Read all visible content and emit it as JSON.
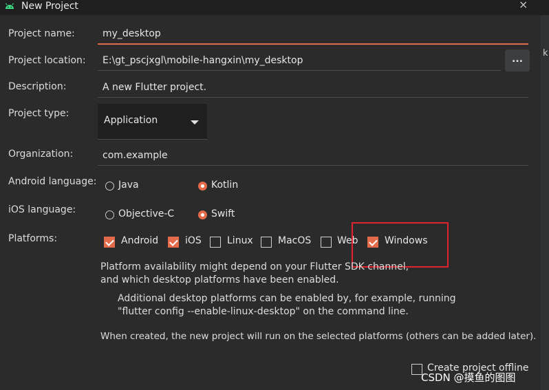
{
  "window": {
    "title": "New Project",
    "close_glyph": "×"
  },
  "form": {
    "project_name": {
      "label": "Project name:",
      "value": "my_desktop"
    },
    "project_location": {
      "label": "Project location:",
      "value": "E:\\gt_pscjxgl\\mobile-hangxin\\my_desktop",
      "browse_label": "..."
    },
    "description": {
      "label": "Description:",
      "value": "A new Flutter project."
    },
    "project_type": {
      "label": "Project type:",
      "value": "Application"
    },
    "organization": {
      "label": "Organization:",
      "value": "com.example"
    },
    "android_language": {
      "label": "Android language:",
      "options": [
        {
          "label": "Java",
          "selected": false
        },
        {
          "label": "Kotlin",
          "selected": true
        }
      ]
    },
    "ios_language": {
      "label": "iOS language:",
      "options": [
        {
          "label": "Objective-C",
          "selected": false
        },
        {
          "label": "Swift",
          "selected": true
        }
      ]
    },
    "platforms": {
      "label": "Platforms:",
      "items": [
        {
          "label": "Android",
          "checked": true
        },
        {
          "label": "iOS",
          "checked": true
        },
        {
          "label": "Linux",
          "checked": false
        },
        {
          "label": "MacOS",
          "checked": false
        },
        {
          "label": "Web",
          "checked": false
        },
        {
          "label": "Windows",
          "checked": true
        }
      ]
    }
  },
  "info": {
    "line1": "Platform availability might depend on your Flutter SDK channel,",
    "line2": "and which desktop platforms have been enabled.",
    "line3": "Additional desktop platforms can be enabled by, for example, running",
    "line4": "\"flutter config --enable-linux-desktop\" on the command line.",
    "line5": "When created, the new project will run on the selected platforms (others can be added later)."
  },
  "offline": {
    "label": "Create project offline",
    "checked": false
  },
  "right_edge_text": "k",
  "watermark": "CSDN @摸鱼的图图",
  "colors": {
    "accent": "#e36a4a",
    "background": "#2b2b2b",
    "highlight": "#e0232e"
  }
}
